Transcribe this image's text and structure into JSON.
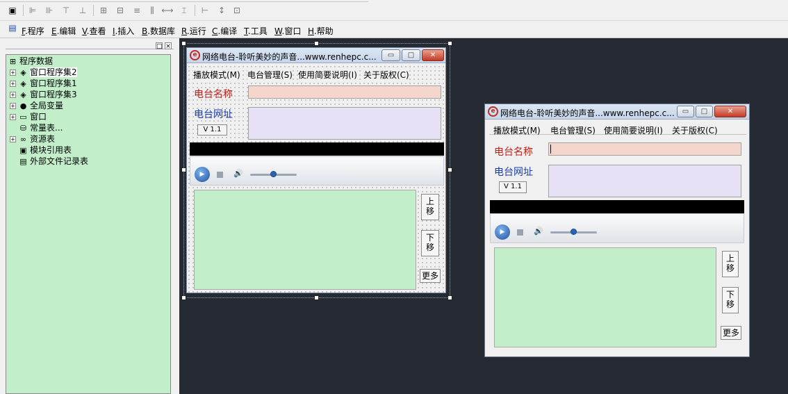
{
  "menubar": {
    "items": [
      {
        "key": "F",
        "label": ".程序"
      },
      {
        "key": "E",
        "label": ".编辑"
      },
      {
        "key": "V",
        "label": ".查看"
      },
      {
        "key": "I",
        "label": ".插入"
      },
      {
        "key": "B",
        "label": ".数据库"
      },
      {
        "key": "R",
        "label": ".运行"
      },
      {
        "key": "C",
        "label": ".编译"
      },
      {
        "key": "T",
        "label": ".工具"
      },
      {
        "key": "W",
        "label": ".窗口"
      },
      {
        "key": "H",
        "label": ".帮助"
      }
    ]
  },
  "panel": {
    "pin_label": "□",
    "close_label": "×"
  },
  "tree": {
    "root": "程序数据",
    "items": [
      {
        "label": "窗口程序集2",
        "icon": "module-icon"
      },
      {
        "label": "窗口程序集1",
        "icon": "module-icon"
      },
      {
        "label": "窗口程序集3",
        "icon": "module-icon"
      },
      {
        "label": "全局变量",
        "icon": "variable-icon"
      },
      {
        "label": "窗口",
        "icon": "window-icon"
      },
      {
        "label": "常量表...",
        "icon": "constant-icon"
      },
      {
        "label": "资源表",
        "icon": "resource-icon"
      },
      {
        "label": "模块引用表",
        "icon": "module-ref-icon"
      },
      {
        "label": "外部文件记录表",
        "icon": "file-icon"
      }
    ]
  },
  "design_window": {
    "title": "网络电台-聆听美妙的声音...www.renhepc.c...",
    "menu": [
      "播放模式(M)",
      "电台管理(S)",
      "使用简要说明(I)",
      "关于版权(C)"
    ],
    "station_name_label": "电台名称",
    "station_url_label": "电台网址",
    "version": "V 1.1",
    "move_up": "上\n移",
    "move_down": "下\n移",
    "more": "更多"
  },
  "preview_window": {
    "title": "网络电台-聆听美妙的声音...www.renhepc.c...",
    "menu": [
      "播放模式(M)",
      "电台管理(S)",
      "使用简要说明(I)",
      "关于版权(C)"
    ],
    "station_name_label": "电台名称",
    "station_url_label": "电台网址",
    "version": "V 1.1",
    "move_up": "上\n移",
    "move_down": "下\n移",
    "more": "更多"
  },
  "colors": {
    "tree_bg": "#c2efca",
    "name_field": "#f5d6cc",
    "url_field": "#e6e1f4",
    "workspace": "#262a33"
  }
}
